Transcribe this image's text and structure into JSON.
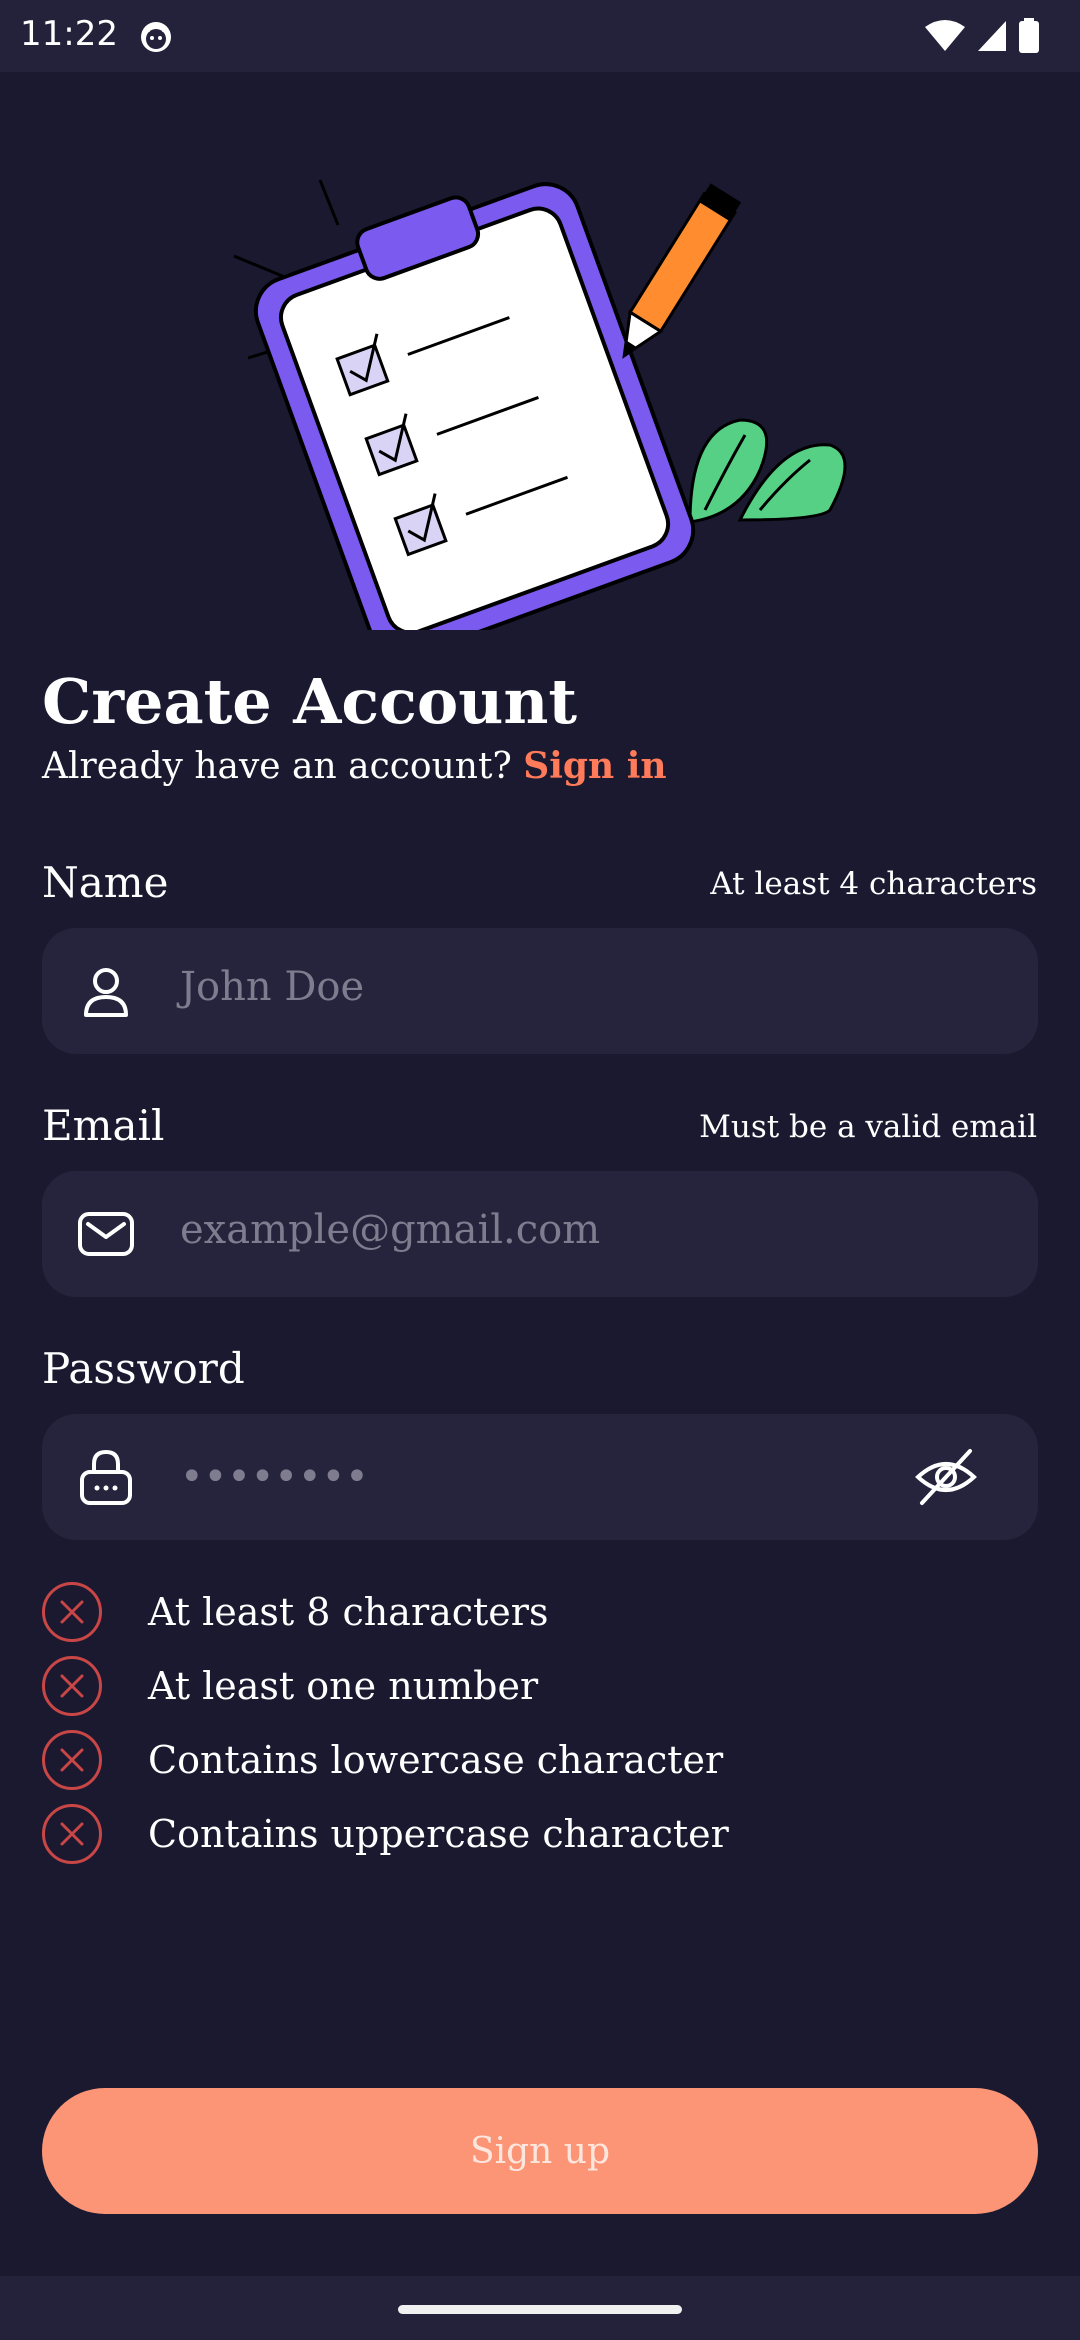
{
  "status_bar": {
    "time": "11:22",
    "icons": [
      "cat-notification-icon",
      "wifi-icon",
      "signal-icon",
      "battery-icon"
    ]
  },
  "header": {
    "title": "Create Account",
    "subtitle": "Already have an account?",
    "signin_link": "Sign in"
  },
  "form": {
    "name": {
      "label": "Name",
      "hint": "At least 4 characters",
      "placeholder": "John Doe",
      "icon": "person-icon"
    },
    "email": {
      "label": "Email",
      "hint": "Must be a valid email",
      "placeholder": "example@gmail.com",
      "icon": "mail-icon"
    },
    "password": {
      "label": "Password",
      "value": "••••••••",
      "icon": "lock-icon",
      "toggle_icon": "eye-off-icon"
    }
  },
  "requirements": [
    {
      "text": "At least 8 characters",
      "met": false
    },
    {
      "text": "At least one number",
      "met": false
    },
    {
      "text": "Contains lowercase character",
      "met": false
    },
    {
      "text": "Contains uppercase character",
      "met": false
    }
  ],
  "actions": {
    "signup_label": "Sign up"
  },
  "colors": {
    "background": "#1b1930",
    "field_bg": "#26243c",
    "accent": "#ff7b59",
    "button": "#fc9576",
    "error": "#c94646"
  }
}
